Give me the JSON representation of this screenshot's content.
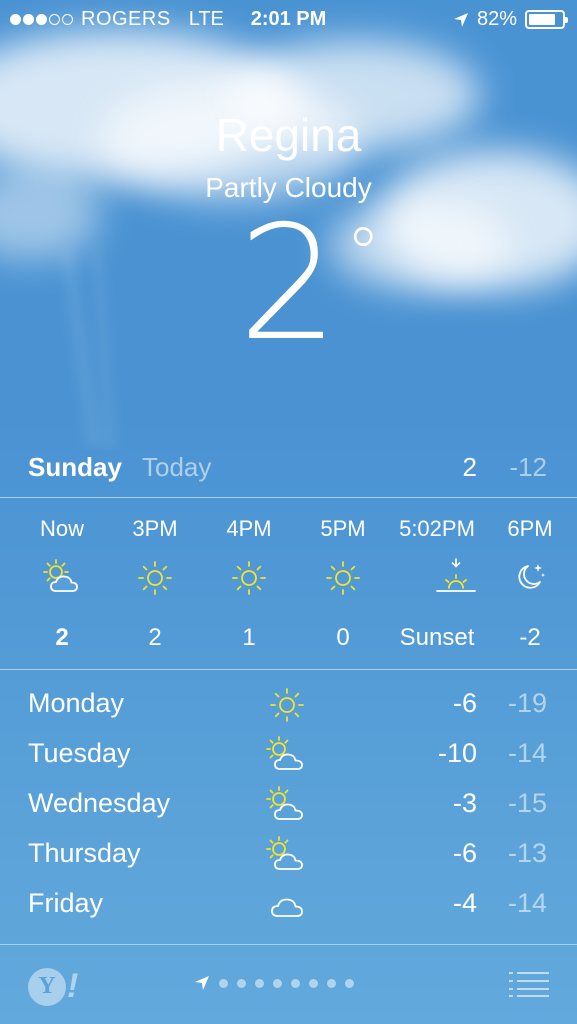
{
  "status_bar": {
    "signal_bars_on": 3,
    "signal_bars_total": 5,
    "carrier": "ROGERS",
    "network": "LTE",
    "time": "2:01 PM",
    "battery": "82%",
    "battery_level": 0.82,
    "location_icon": "location-arrow-icon"
  },
  "current": {
    "city": "Regina",
    "condition": "Partly Cloudy",
    "temperature": "2",
    "degree_symbol": "°"
  },
  "today": {
    "day": "Sunday",
    "label": "Today",
    "high": "2",
    "low": "-12"
  },
  "hourly": [
    {
      "time": "Now",
      "icon": "partly-cloudy-icon",
      "temp": "2"
    },
    {
      "time": "3PM",
      "icon": "sun-icon",
      "temp": "2"
    },
    {
      "time": "4PM",
      "icon": "sun-icon",
      "temp": "1"
    },
    {
      "time": "5PM",
      "icon": "sun-icon",
      "temp": "0"
    },
    {
      "time": "5:02PM",
      "icon": "sunset-icon",
      "temp": "Sunset"
    },
    {
      "time": "6PM",
      "icon": "moon-icon",
      "temp": "-2"
    }
  ],
  "daily": [
    {
      "day": "Monday",
      "icon": "sun-icon",
      "high": "-6",
      "low": "-19"
    },
    {
      "day": "Tuesday",
      "icon": "partly-cloudy-icon",
      "high": "-10",
      "low": "-14"
    },
    {
      "day": "Wednesday",
      "icon": "partly-cloudy-icon",
      "high": "-3",
      "low": "-15"
    },
    {
      "day": "Thursday",
      "icon": "partly-cloudy-icon",
      "high": "-6",
      "low": "-13"
    },
    {
      "day": "Friday",
      "icon": "cloud-icon",
      "high": "-4",
      "low": "-14"
    }
  ],
  "bottom_bar": {
    "yahoo_letter": "Y",
    "yahoo_bang": "!",
    "page_count": 8,
    "icons": [
      "yahoo-logo-icon",
      "location-arrow-icon",
      "list-icon"
    ]
  },
  "colors": {
    "sky": "#4a92d2",
    "sun": "#f3e32a",
    "text": "#ffffff",
    "muted_text": "rgba(255,255,255,0.55)"
  }
}
